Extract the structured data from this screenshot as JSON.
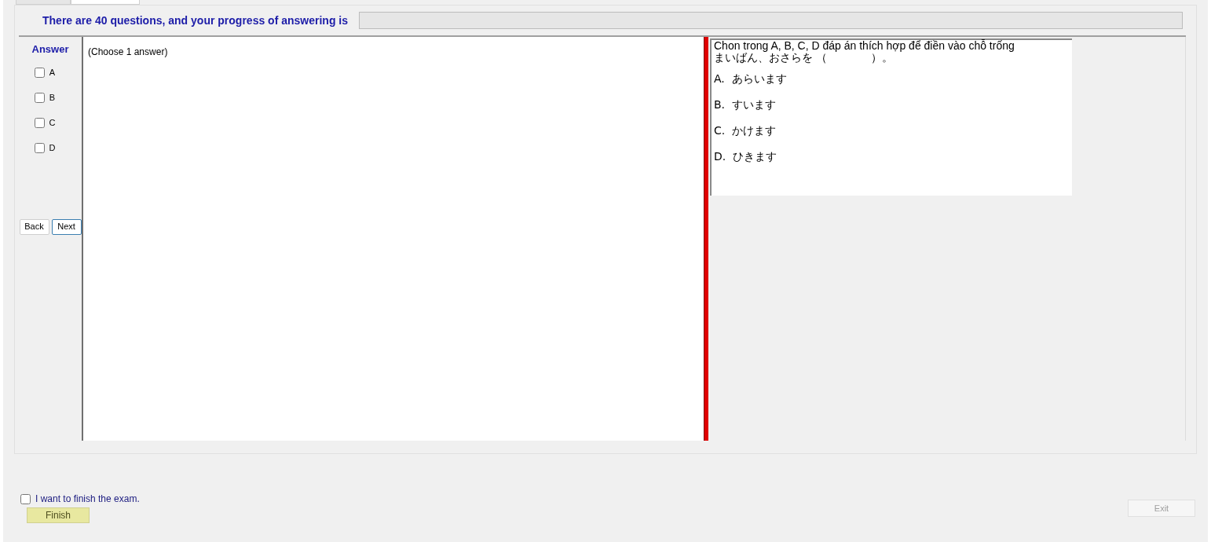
{
  "tabs": [
    {
      "selected": false
    },
    {
      "selected": true
    }
  ],
  "progress": {
    "text": "There are 40 questions, and your progress of answering is",
    "level": 0
  },
  "answer": {
    "title": "Answer",
    "options": [
      {
        "label": "A",
        "checked": false
      },
      {
        "label": "B",
        "checked": false
      },
      {
        "label": "C",
        "checked": false
      },
      {
        "label": "D",
        "checked": false
      }
    ],
    "back": "Back",
    "next": "Next"
  },
  "answer_area": {
    "hint": "(Choose 1 answer)"
  },
  "question": {
    "instruction": "Chon trong A, B, C, D đáp án thích hợp để điền vào chỗ trống",
    "stem": "まいばん、おさらを （　　　　）。",
    "choices": [
      "A.  あらいます",
      "B.  すいます",
      "C.  かけます",
      "D.  ひきます"
    ]
  },
  "finish": {
    "label": "I want to finish the exam.",
    "checked": false,
    "button": "Finish"
  },
  "exit": {
    "label": "Exit",
    "disabled": true
  }
}
